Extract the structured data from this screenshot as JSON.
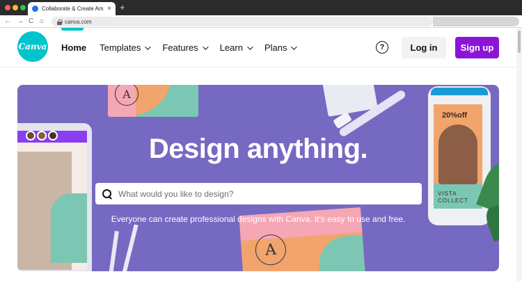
{
  "browser": {
    "tab_title": "Collaborate & Create Amazing",
    "tab_close": "×",
    "new_tab": "+",
    "url": "canva.com",
    "nav_back": "←",
    "nav_forward": "→",
    "nav_reload": "C",
    "nav_home": "⌂"
  },
  "header": {
    "logo_text": "Canva",
    "nav_items": [
      {
        "label": "Home",
        "active": true
      },
      {
        "label": "Templates"
      },
      {
        "label": "Features"
      },
      {
        "label": "Learn"
      },
      {
        "label": "Plans"
      }
    ],
    "help_label": "?",
    "login_label": "Log in",
    "signup_label": "Sign up"
  },
  "hero": {
    "title": "Design anything.",
    "search_placeholder": "What would you like to design?",
    "subtitle": "Everyone can create professional designs with Canva. It's easy to use and free.",
    "card_letter": "A",
    "phone_discount": "20%off",
    "phone_brand_line1": "VISTA",
    "phone_brand_line2": "COLLECT"
  },
  "colors": {
    "brand_teal": "#00c4cc",
    "signup_purple": "#8b15d6",
    "hero_bg": "#7669c2"
  }
}
